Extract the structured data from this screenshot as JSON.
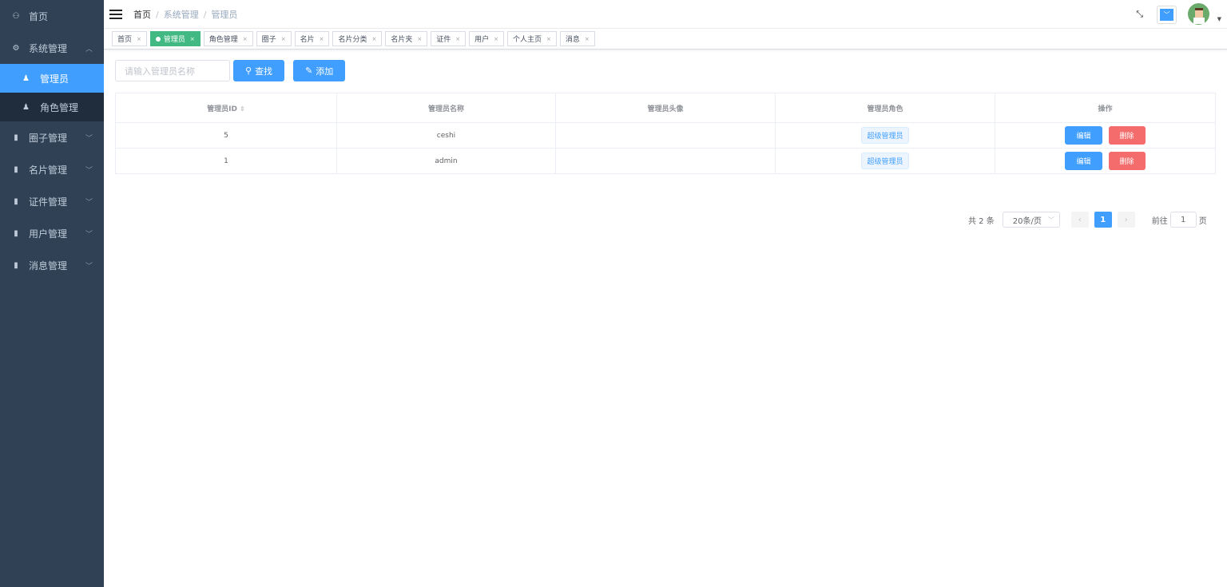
{
  "sidebar": {
    "items": [
      {
        "label": "首页",
        "icon": "dashboard-icon"
      },
      {
        "label": "系统管理",
        "icon": "gear-icon",
        "sub": [
          {
            "label": "管理员"
          },
          {
            "label": "角色管理"
          }
        ]
      },
      {
        "label": "圈子管理"
      },
      {
        "label": "名片管理"
      },
      {
        "label": "证件管理"
      },
      {
        "label": "用户管理"
      },
      {
        "label": "消息管理"
      }
    ]
  },
  "breadcrumb": [
    "首页",
    "系统管理",
    "管理员"
  ],
  "tags": [
    "首页",
    "管理员",
    "角色管理",
    "圈子",
    "名片",
    "名片分类",
    "名片夹",
    "证件",
    "用户",
    "个人主页",
    "消息"
  ],
  "toolbar": {
    "placeholder": "请输入管理员名称",
    "search": "查找",
    "add": "添加"
  },
  "table": {
    "headers": [
      "管理员ID",
      "管理员名称",
      "管理员头像",
      "管理员角色",
      "操作"
    ],
    "rows": [
      {
        "id": "5",
        "name": "ceshi",
        "role": "超级管理员"
      },
      {
        "id": "1",
        "name": "admin",
        "role": "超级管理员"
      }
    ],
    "edit": "编辑",
    "delete": "删除"
  },
  "pager": {
    "total": "共 2 条",
    "size": "20条/页",
    "current": "1",
    "goto": "前往",
    "goto_value": "1",
    "page_unit": "页"
  }
}
